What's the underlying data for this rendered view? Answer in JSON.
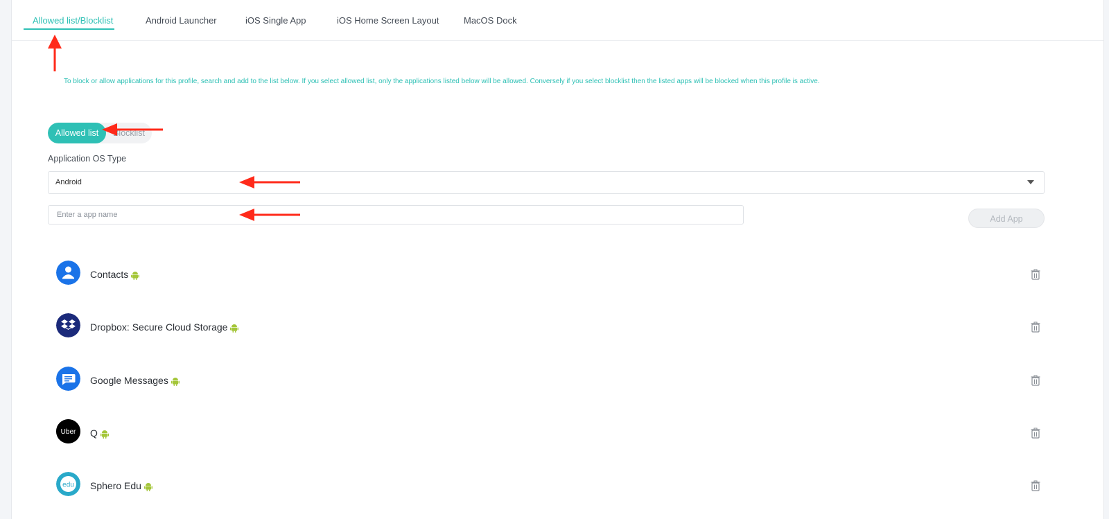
{
  "tabs": [
    {
      "label": "Allowed list/Blocklist",
      "active": true
    },
    {
      "label": "Android Launcher",
      "active": false
    },
    {
      "label": "iOS Single App",
      "active": false
    },
    {
      "label": "iOS Home Screen Layout",
      "active": false
    },
    {
      "label": "MacOS Dock",
      "active": false
    }
  ],
  "description": "To block or allow applications for this profile, search and add to the list below. If you select allowed list, only the applications listed below will be allowed. Conversely if you select blocklist then the listed apps will be blocked when this profile is active.",
  "mode_toggle": {
    "allowed_label": "Allowed list",
    "block_label": "Blocklist",
    "selected": "Allowed list"
  },
  "os_type": {
    "label": "Application OS Type",
    "value": "Android"
  },
  "search": {
    "placeholder": "Enter a app name"
  },
  "add_button": {
    "label": "Add App"
  },
  "apps": [
    {
      "name": "Contacts",
      "icon": "contacts-icon"
    },
    {
      "name": "Dropbox: Secure Cloud Storage",
      "icon": "dropbox-icon"
    },
    {
      "name": "Google Messages",
      "icon": "messages-icon"
    },
    {
      "name": "Q",
      "icon": "uber-icon",
      "icon_text": "Uber"
    },
    {
      "name": "Sphero Edu",
      "icon": "sphero-edu-icon",
      "icon_text": "edu"
    }
  ],
  "colors": {
    "accent": "#2ec0b5",
    "annotation_arrow": "#ff2a1a",
    "android_green": "#a4c639"
  }
}
